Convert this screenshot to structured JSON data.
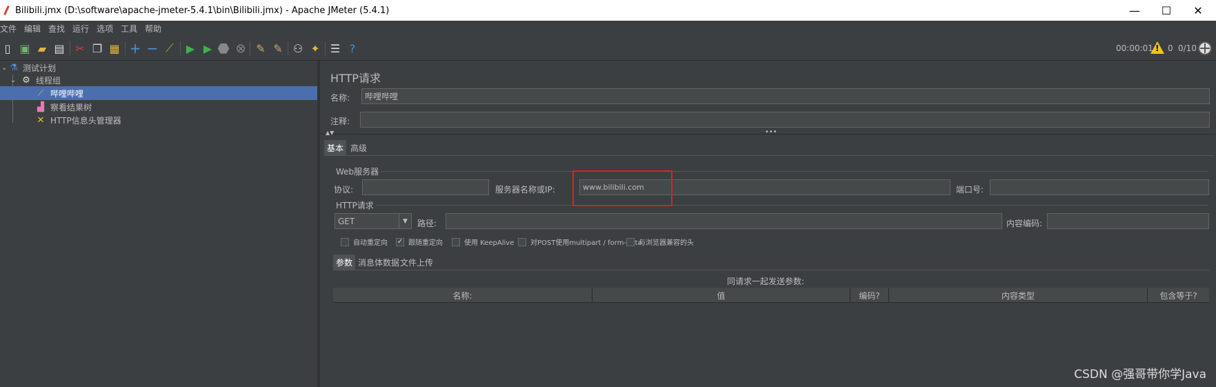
{
  "window": {
    "title": "Bilibili.jmx (D:\\software\\apache-jmeter-5.4.1\\bin\\Bilibili.jmx) - Apache JMeter (5.4.1)",
    "minimize": "—",
    "maximize": "☐",
    "close": "✕"
  },
  "menu": [
    "文件",
    "编辑",
    "查找",
    "运行",
    "选项",
    "工具",
    "帮助"
  ],
  "status": {
    "time": "00:00:01",
    "warnings": "0",
    "threads": "0/10"
  },
  "tree": {
    "items": [
      {
        "label": "测试计划",
        "icon": "flask-icon"
      },
      {
        "label": "线程组",
        "icon": "gear-icon"
      },
      {
        "label": "哔哩哔哩",
        "icon": "pipette-icon"
      },
      {
        "label": "察看结果树",
        "icon": "chart-icon"
      },
      {
        "label": "HTTP信息头管理器",
        "icon": "tools-icon"
      }
    ]
  },
  "panel": {
    "title": "HTTP请求",
    "name_label": "名称:",
    "name_value": "哔哩哔哩",
    "comment_label": "注释:",
    "comment_value": "",
    "tabs": [
      "基本",
      "高级"
    ],
    "web_server": {
      "group_title": "Web服务器",
      "protocol_label": "协议:",
      "protocol_value": "",
      "server_label": "服务器名称或IP:",
      "server_value": "www.bilibili.com",
      "port_label": "端口号:",
      "port_value": ""
    },
    "http_request": {
      "group_title": "HTTP请求",
      "method": "GET",
      "path_label": "路径:",
      "path_value": "",
      "encoding_label": "内容编码:",
      "encoding_value": ""
    },
    "checkboxes": [
      {
        "label": "自动重定向",
        "checked": false
      },
      {
        "label": "跟随重定向",
        "checked": true
      },
      {
        "label": "使用 KeepAlive",
        "checked": false
      },
      {
        "label": "对POST使用multipart / form-data",
        "checked": false
      },
      {
        "label": "与浏览器兼容的头",
        "checked": false
      }
    ],
    "subtabs": [
      "参数",
      "消息体数据",
      "文件上传"
    ],
    "params_caption": "同请求一起发送参数:",
    "columns": [
      "名称:",
      "值",
      "编码?",
      "内容类型",
      "包含等于?"
    ]
  },
  "watermark": "CSDN @强哥带你学Java",
  "colors": {
    "background": "#3c3f41",
    "selection": "#4b6eaf",
    "highlight": "#e02020"
  }
}
